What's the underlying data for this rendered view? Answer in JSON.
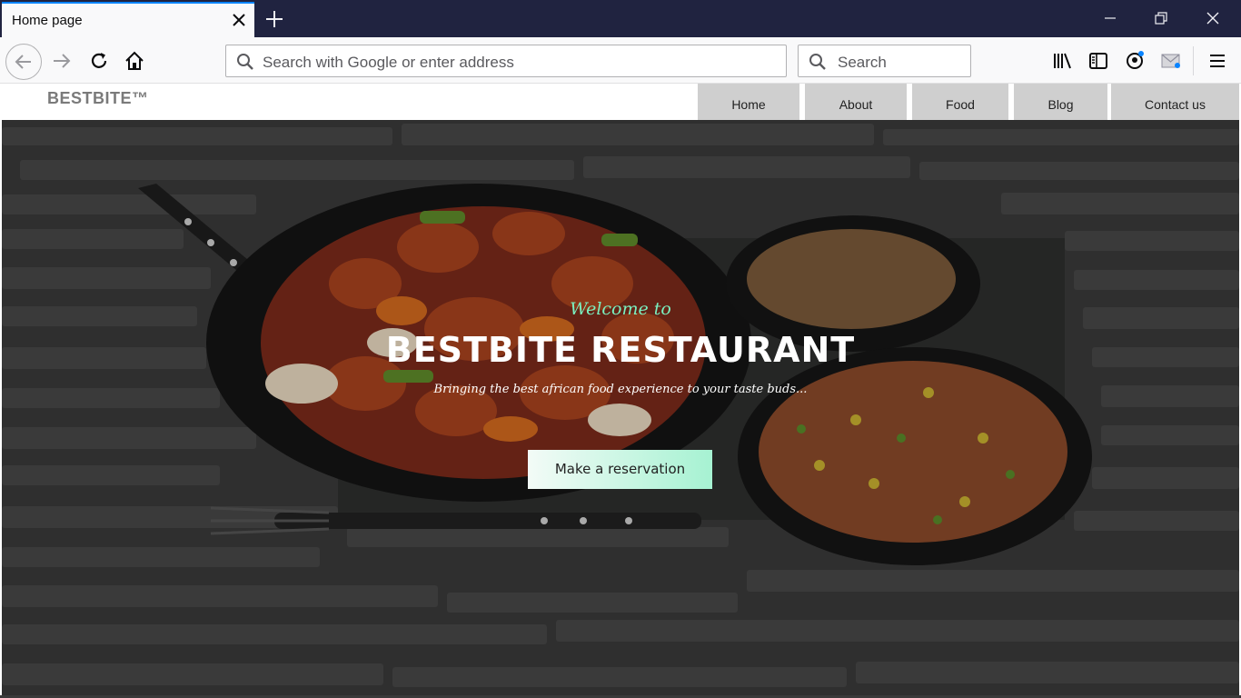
{
  "browser": {
    "tab_title": "Home page",
    "url_placeholder": "Search with Google or enter address",
    "search_placeholder": "Search",
    "colors": {
      "titlebar": "#202340",
      "tab_accent": "#0a84ff"
    }
  },
  "site": {
    "brand": "BESTBITE™",
    "menu": [
      {
        "label": "Home"
      },
      {
        "label": "About"
      },
      {
        "label": "Food"
      },
      {
        "label": "Blog"
      },
      {
        "label": "Contact us"
      }
    ]
  },
  "hero": {
    "welcome": "Welcome to",
    "headline": "BESTBITE RESTAURANT",
    "tagline": "Bringing the best african food experience to your taste buds...",
    "cta_label": "Make a reservation",
    "colors": {
      "welcome": "#7af0c0",
      "cta_gradient_end": "#a6f2d2"
    }
  }
}
